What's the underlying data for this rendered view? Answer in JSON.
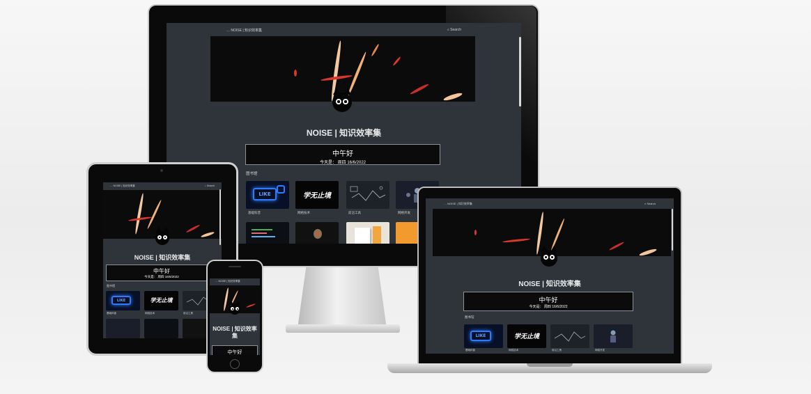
{
  "site": {
    "nav_title": "NOISE | 知识效率集",
    "search_label": "Search",
    "site_title": "NOISE | 知识效率集",
    "greeting": "中午好",
    "date_line": "今天是：  周四 16/6/2022",
    "section_label": "图书馆",
    "cards": [
      {
        "label": "基础科普",
        "art": "LIKE"
      },
      {
        "label": "网络技术",
        "art": "学无止境"
      },
      {
        "label": "前沿工具",
        "art": "laptop"
      },
      {
        "label": "网络开发",
        "art": "people"
      }
    ]
  },
  "phone": {
    "site_title": "NOISE | 知识效率集"
  },
  "colors": {
    "page_bg": "#2e3439",
    "banner_bg": "#0b0b0c",
    "streak_orange": "#f2b58b",
    "streak_red": "#d8392b",
    "accent_blue": "#2f7bff"
  },
  "icons": [
    "search-icon",
    "menu-icon",
    "cat-mascot-icon"
  ]
}
